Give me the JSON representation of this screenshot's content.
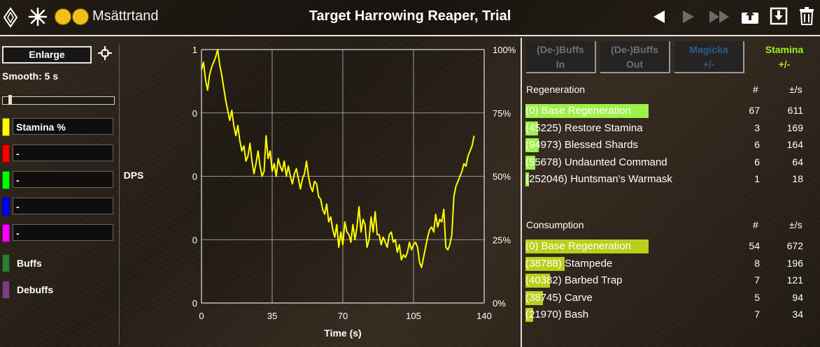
{
  "header": {
    "character_name": "Msättrtand",
    "fight_title": "Target Harrowing Reaper, Trial",
    "icons": [
      "diamond-icon",
      "sun-icon",
      "avatar-icon",
      "avatar-icon",
      "back-arrow-icon",
      "play-icon",
      "fast-forward-icon",
      "upload-icon",
      "download-icon",
      "trash-icon"
    ]
  },
  "left_panel": {
    "enlarge_label": "Enlarge",
    "smooth_label": "Smooth: 5 s",
    "smooth_slider_fraction": 0.06,
    "selectors": [
      {
        "label": "Stamina %",
        "color": "#ffff00"
      },
      {
        "label": "-",
        "color": "#ff0000"
      },
      {
        "label": "-",
        "color": "#00ff00"
      },
      {
        "label": "-",
        "color": "#0000ff"
      },
      {
        "label": "-",
        "color": "#ff00ff"
      }
    ],
    "buffs_label": "Buffs",
    "buffs_color": "#2e7d32",
    "debuffs_label": "Debuffs",
    "debuffs_color": "#7b3d7f"
  },
  "chart_data": {
    "type": "line",
    "xlabel": "Time (s)",
    "ylabel": "DPS",
    "left_ticks": [
      "1",
      "0",
      "0",
      "0",
      "0"
    ],
    "right_ticks": [
      "100%",
      "75%",
      "50%",
      "25%",
      "0%"
    ],
    "x_ticks": [
      "0",
      "35",
      "70",
      "105",
      "140"
    ],
    "xlim": [
      0,
      140
    ],
    "ylim": [
      0,
      100
    ],
    "grid": true,
    "series": [
      {
        "name": "Stamina %",
        "color": "#ffff00",
        "x": [
          0,
          1,
          2,
          3,
          4,
          5,
          6,
          7,
          8,
          9,
          10,
          11,
          12,
          13,
          14,
          15,
          16,
          17,
          18,
          19,
          20,
          21,
          22,
          23,
          24,
          25,
          26,
          27,
          28,
          29,
          30,
          31,
          32,
          33,
          34,
          35,
          36,
          37,
          38,
          39,
          40,
          41,
          42,
          43,
          44,
          45,
          46,
          47,
          48,
          49,
          50,
          51,
          52,
          53,
          54,
          55,
          56,
          57,
          58,
          59,
          60,
          61,
          62,
          63,
          64,
          65,
          66,
          67,
          68,
          69,
          70,
          71,
          72,
          73,
          74,
          75,
          76,
          77,
          78,
          79,
          80,
          81,
          82,
          83,
          84,
          85,
          86,
          87,
          88,
          89,
          90,
          91,
          92,
          93,
          94,
          95,
          96,
          97,
          98,
          99,
          100,
          101,
          102,
          103,
          104,
          105,
          106,
          107,
          108,
          109,
          110,
          111,
          112,
          113,
          114,
          115,
          116,
          117,
          118,
          119,
          120,
          121,
          122,
          123,
          124,
          125,
          126,
          127,
          128,
          129,
          130,
          131,
          132,
          133,
          134,
          135
        ],
        "values": [
          92,
          95,
          88,
          84,
          90,
          93,
          95,
          97,
          100,
          94,
          90,
          85,
          80,
          76,
          72,
          76,
          70,
          66,
          70,
          64,
          60,
          62,
          56,
          58,
          63,
          56,
          51,
          55,
          60,
          54,
          50,
          52,
          66,
          57,
          60,
          52,
          55,
          50,
          57,
          54,
          52,
          56,
          50,
          54,
          50,
          47,
          51,
          53,
          49,
          45,
          49,
          51,
          56,
          50,
          46,
          44,
          48,
          47,
          42,
          41,
          37,
          35,
          39,
          32,
          34,
          29,
          26,
          31,
          22,
          28,
          23,
          32,
          28,
          27,
          24,
          31,
          25,
          30,
          38,
          28,
          33,
          31,
          22,
          25,
          34,
          28,
          36,
          27,
          27,
          23,
          26,
          24,
          22,
          27,
          28,
          24,
          25,
          20,
          23,
          17,
          19,
          18,
          20,
          24,
          21,
          23,
          24,
          22,
          16,
          14,
          18,
          22,
          26,
          29,
          30,
          28,
          35,
          30,
          33,
          32,
          37,
          22,
          21,
          23,
          27,
          42,
          46,
          48,
          50,
          52,
          55,
          54,
          58,
          60,
          62,
          66
        ]
      }
    ]
  },
  "right_panel": {
    "tabs": [
      {
        "line1": "(De-)Buffs",
        "line2": "In",
        "active": false,
        "color": "#707070"
      },
      {
        "line1": "(De-)Buffs",
        "line2": "Out",
        "active": false,
        "color": "#707070"
      },
      {
        "line1": "Magicka",
        "line2": "+/-",
        "active": false,
        "color": "#2f5c8a"
      },
      {
        "line1": "Stamina",
        "line2": "+/-",
        "active": true,
        "color": "#9cf51e"
      }
    ],
    "regeneration": {
      "title": "Regeneration",
      "count_header": "#",
      "rate_header": "±/s",
      "bar_color": "#9ef04a",
      "rows": [
        {
          "name": "(0) Base Regeneration",
          "count": "67",
          "rate": "611",
          "bar_fraction": 1.0
        },
        {
          "name": "(45225) Restore Stamina",
          "count": "3",
          "rate": "169",
          "bar_fraction": 0.1
        },
        {
          "name": "(94973) Blessed Shards",
          "count": "6",
          "rate": "164",
          "bar_fraction": 0.11
        },
        {
          "name": "(55678) Undaunted Command",
          "count": "6",
          "rate": "64",
          "bar_fraction": 0.08
        },
        {
          "name": "(252046) Huntsman's Warmask",
          "count": "1",
          "rate": "18",
          "bar_fraction": 0.03
        }
      ]
    },
    "consumption": {
      "title": "Consumption",
      "count_header": "#",
      "rate_header": "±/s",
      "bar_color": "#b9d01a",
      "rows": [
        {
          "name": "(0) Base Regeneration",
          "count": "54",
          "rate": "672",
          "bar_fraction": 1.0
        },
        {
          "name": "(38788) Stampede",
          "count": "8",
          "rate": "196",
          "bar_fraction": 0.32
        },
        {
          "name": "(40382) Barbed Trap",
          "count": "7",
          "rate": "121",
          "bar_fraction": 0.2
        },
        {
          "name": "(38745) Carve",
          "count": "5",
          "rate": "94",
          "bar_fraction": 0.14
        },
        {
          "name": "(21970) Bash",
          "count": "7",
          "rate": "34",
          "bar_fraction": 0.06
        }
      ]
    }
  }
}
